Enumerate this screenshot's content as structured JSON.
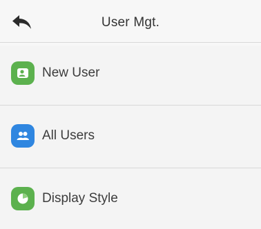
{
  "header": {
    "title": "User Mgt.",
    "back_icon": "back-arrow-icon"
  },
  "menu": [
    {
      "label": "New User",
      "icon": "new-user-icon",
      "color": "#5cb14e"
    },
    {
      "label": "All Users",
      "icon": "all-users-icon",
      "color": "#2f86e0"
    },
    {
      "label": "Display Style",
      "icon": "display-style-icon",
      "color": "#5cb14e"
    }
  ]
}
